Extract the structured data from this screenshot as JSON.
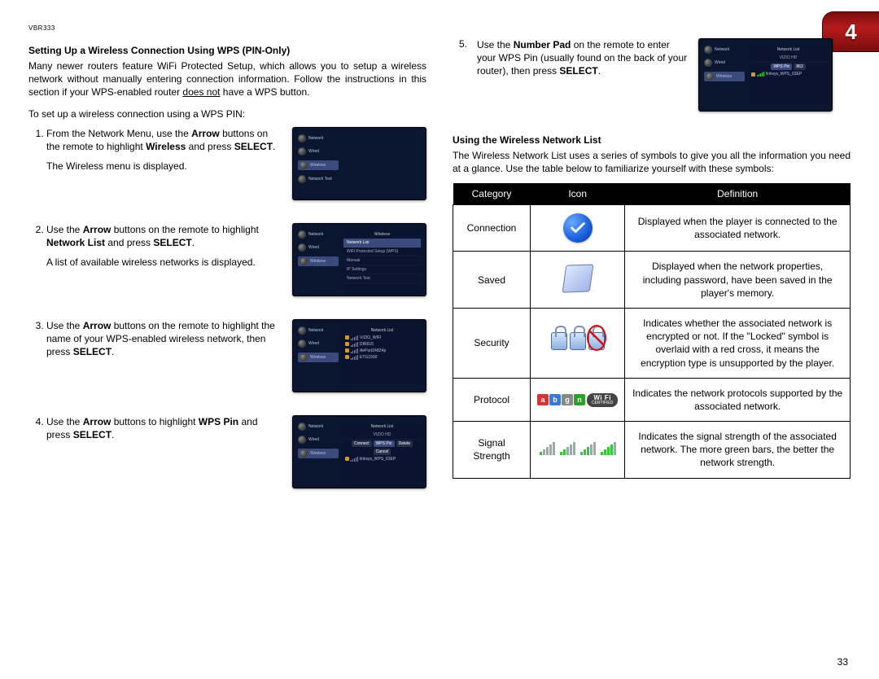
{
  "header": {
    "model": "VBR333",
    "chapter_number": "4"
  },
  "left": {
    "section_title": "Setting Up a Wireless Connection Using WPS (PIN-Only)",
    "intro_before_underline": "Many newer routers feature WiFi Protected Setup, which allows you to setup a wireless network without manually entering connection information. Follow the instructions in this section if your WPS-enabled router ",
    "intro_underline": "does not",
    "intro_after_underline": " have a WPS button.",
    "lead": "To set up a wireless connection using a WPS PIN:",
    "steps": [
      {
        "lines": [
          [
            {
              "t": "From the Network Menu, use the "
            },
            {
              "t": "Arrow",
              "b": true
            },
            {
              "t": " buttons on the remote to highlight "
            },
            {
              "t": "Wireless",
              "b": true
            },
            {
              "t": " and press "
            },
            {
              "t": "SELECT",
              "b": true
            },
            {
              "t": "."
            }
          ],
          [
            {
              "t": "The Wireless menu is displayed."
            }
          ]
        ],
        "thumb_type": "menu",
        "thumb_menu": [
          "Network",
          "Wired",
          "Wireless",
          "Network Test"
        ],
        "thumb_selected": 2
      },
      {
        "lines": [
          [
            {
              "t": "Use the "
            },
            {
              "t": "Arrow",
              "b": true
            },
            {
              "t": " buttons on the remote to highlight "
            },
            {
              "t": "Network List",
              "b": true
            },
            {
              "t": " and press "
            },
            {
              "t": "SELECT",
              "b": true
            },
            {
              "t": "."
            }
          ],
          [
            {
              "t": "A list of available wireless networks is displayed."
            }
          ]
        ],
        "thumb_type": "submenu",
        "thumb_title": "Wireless",
        "thumb_rows": [
          "Network List",
          "WiFi Protected Setup (WPS)",
          "Manual",
          "IP Settings",
          "Network Test"
        ],
        "thumb_hl": 0
      },
      {
        "lines": [
          [
            {
              "t": "Use the "
            },
            {
              "t": "Arrow",
              "b": true
            },
            {
              "t": " buttons on the remote to highlight the name of your WPS-enabled wireless network, then press "
            },
            {
              "t": "SELECT",
              "b": true
            },
            {
              "t": "."
            }
          ]
        ],
        "thumb_type": "netlist",
        "thumb_title": "Network List",
        "thumb_nets": [
          "VIZIO_WIFI",
          "DIR615",
          "AirPort248Z4p",
          "ETG1500"
        ],
        "thumb_hl": 0
      },
      {
        "lines": [
          [
            {
              "t": "Use the "
            },
            {
              "t": "Arrow",
              "b": true
            },
            {
              "t": " buttons to highlight "
            },
            {
              "t": "WPS Pin",
              "b": true
            },
            {
              "t": " and press "
            },
            {
              "t": "SELECT",
              "b": true
            },
            {
              "t": "."
            }
          ]
        ],
        "thumb_type": "wpspin",
        "thumb_title": "Network List",
        "thumb_net": "VIZIO HD",
        "thumb_actions": [
          "Connect",
          "WPS Pin",
          "Delete",
          "Cancel"
        ],
        "thumb_hl": 1,
        "thumb_extra": "linksys_WPS_63EP"
      }
    ]
  },
  "right": {
    "step5": {
      "num": "5.",
      "segments": [
        {
          "t": "Use the "
        },
        {
          "t": "Number Pad",
          "b": true
        },
        {
          "t": " on the remote to enter your WPS Pin (usually found on the back of your router), then press "
        },
        {
          "t": "SELECT",
          "b": true
        },
        {
          "t": "."
        }
      ],
      "thumb_title": "Network List",
      "thumb_net": "VIZIO HD",
      "thumb_pin_label": "WPS Pin",
      "thumb_pin_value": "863",
      "thumb_extra": "linksys_WPS_63EP",
      "thumb_footer": "Linksys, WPS, 63EP"
    },
    "section_title": "Using the Wireless Network List",
    "intro": "The Wireless Network List uses a series of symbols to give you all the information you need at a glance. Use the table below to familiarize yourself with these symbols:",
    "table": {
      "headers": [
        "Category",
        "Icon",
        "Definition"
      ],
      "rows": [
        {
          "category": "Connection",
          "icon": "check",
          "definition": "Displayed when the player is connected to the associated network."
        },
        {
          "category": "Saved",
          "icon": "save",
          "definition": "Displayed when the network properties, including password, have been saved in the player's memory."
        },
        {
          "category": "Security",
          "icon": "locks",
          "definition": "Indicates whether the associated network is encrypted or not. If the \"Locked\" symbol is overlaid with a red cross, it means the encryption type is unsupported by the player."
        },
        {
          "category": "Protocol",
          "icon": "proto",
          "definition": "Indicates the network protocols supported by the associated network."
        },
        {
          "category": "Signal Strength",
          "icon": "bars",
          "definition": "Indicates the signal strength of the associated network. The more green bars, the better the network strength."
        }
      ],
      "proto_letters": [
        "a",
        "b",
        "g",
        "n"
      ],
      "wifi_label": "Wi Fi",
      "wifi_sub": "CERTIFIED"
    }
  },
  "page_number": "33"
}
